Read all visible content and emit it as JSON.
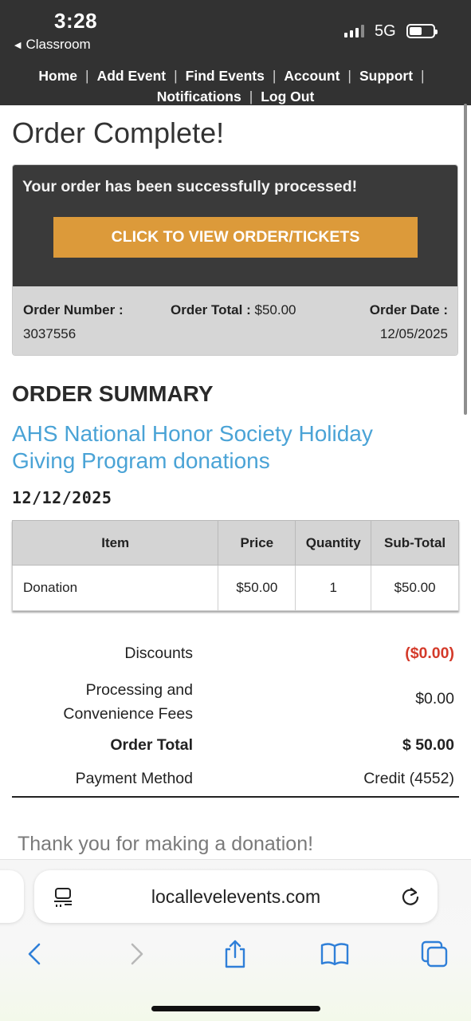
{
  "status_bar": {
    "time": "3:28",
    "back_app": "Classroom",
    "network": "5G",
    "signal_bars": 3,
    "battery_level": 0.55
  },
  "nav": {
    "row1": [
      "Home",
      "Add Event",
      "Find Events",
      "Account",
      "Support"
    ],
    "row2": [
      "Notifications",
      "Log Out"
    ],
    "separator": "|"
  },
  "page": {
    "title": "Order Complete!",
    "success_message": "Your order has been successfully processed!",
    "view_button": "CLICK TO VIEW ORDER/TICKETS",
    "order_number_label": "Order Number :",
    "order_number": "3037556",
    "order_total_label": "Order Total :",
    "order_total": "$50.00",
    "order_date_label": "Order Date :",
    "order_date": "12/05/2025",
    "summary_heading": "ORDER SUMMARY",
    "event_name": "AHS National Honor Society Holiday Giving Program donations",
    "event_date": "12/12/2025",
    "thanks": "Thank you for making a donation!"
  },
  "table": {
    "headers": [
      "Item",
      "Price",
      "Quantity",
      "Sub-Total"
    ],
    "rows": [
      [
        "Donation",
        "$50.00",
        "1",
        "$50.00"
      ]
    ]
  },
  "totals": {
    "discounts_label": "Discounts",
    "discounts_value": "($0.00)",
    "fees_label_line1": "Processing and",
    "fees_label_line2": "Convenience Fees",
    "fees_value": "$0.00",
    "order_total_label": "Order Total",
    "order_total_value": "$ 50.00",
    "payment_label": "Payment Method",
    "payment_value": "Credit (4552)"
  },
  "browser": {
    "url": "locallevelevents.com",
    "icons": [
      "reader-icon",
      "reload-icon",
      "back-icon",
      "forward-icon",
      "share-icon",
      "bookmarks-icon",
      "tabs-icon"
    ]
  },
  "colors": {
    "header_bg": "#323232",
    "button_orange": "#dc9a3a",
    "link_blue": "#4aa3d6",
    "discount_red": "#d43a2a"
  }
}
